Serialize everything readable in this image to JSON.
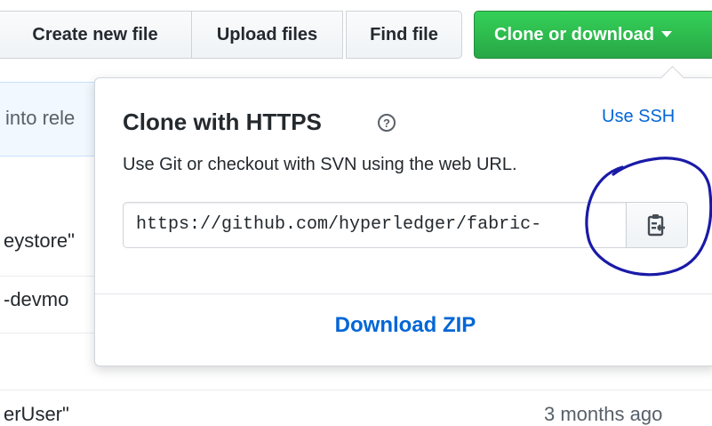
{
  "toolbar": {
    "create_new_file": "Create new file",
    "upload_files": "Upload files",
    "find_file": "Find file",
    "clone_or_download": "Clone or download"
  },
  "background": {
    "banner_text": "into rele",
    "row1_text": "eystore\"",
    "row2_text": "-devmo",
    "row4_text": "erUser\"",
    "row4_time": "3 months ago"
  },
  "clone_popover": {
    "title": "Clone with HTTPS",
    "help_glyph": "?",
    "use_ssh": "Use SSH",
    "description": "Use Git or checkout with SVN using the web URL.",
    "url": "https://github.com/hyperledger/fabric-",
    "copy_icon": "clippy-icon",
    "download_zip": "Download ZIP"
  },
  "colors": {
    "primary_button": "#28a745",
    "link": "#0366d6",
    "annotation": "#1a1aa8"
  }
}
